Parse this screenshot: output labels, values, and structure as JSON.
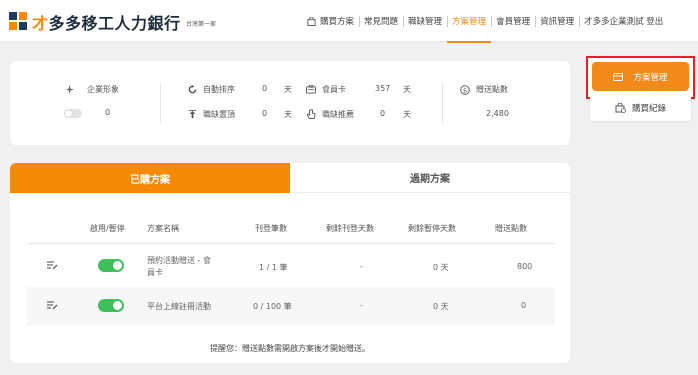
{
  "header": {
    "brand": "才多多移工人力銀行",
    "brand_sub": "台灣第一家",
    "nav": [
      {
        "label": "購買方案",
        "active": false
      },
      {
        "label": "常見問題",
        "active": false
      },
      {
        "label": "職缺管理",
        "active": false
      },
      {
        "label": "方案管理",
        "active": true
      },
      {
        "label": "會員管理",
        "active": false
      },
      {
        "label": "資訊管理",
        "active": false
      },
      {
        "label": "才多多企業測試 登出",
        "active": false
      }
    ]
  },
  "stats": {
    "enterprise_image": {
      "label": "企業形象",
      "value": "0"
    },
    "auto_sort": {
      "label": "自動排序",
      "value": "0",
      "unit": "天"
    },
    "job_top": {
      "label": "職缺置頂",
      "value": "0",
      "unit": "天"
    },
    "member_card": {
      "label": "會員卡",
      "value": "357",
      "unit": "天"
    },
    "job_recommend": {
      "label": "職缺推薦",
      "value": "0",
      "unit": "天"
    },
    "gift_points": {
      "label": "贈送點數",
      "value": "2,480"
    }
  },
  "side_menu": {
    "plan_manage": "方案管理",
    "purchase_record": "購買紀錄"
  },
  "plans": {
    "tabs": [
      "已購方案",
      "過期方案"
    ],
    "columns": [
      "啟用/暫停",
      "方案名稱",
      "刊登筆數",
      "剩餘刊登天數",
      "剩餘暫停天數",
      "贈送點數"
    ],
    "rows": [
      {
        "enabled": true,
        "name": "預約活動贈送 - 會員卡",
        "name_l1": "預約活動贈送 - 會",
        "name_l2": "員卡",
        "count": "1 / 1 筆",
        "remaining_post_days": "-",
        "remaining_pause_days": "0 天",
        "points": "800"
      },
      {
        "enabled": true,
        "name": "平台上線註冊活動",
        "count": "0 / 100 筆",
        "remaining_post_days": "-",
        "remaining_pause_days": "0 天",
        "points": "0"
      }
    ],
    "notice": "提醒您：贈送點數需開啟方案後才開始贈送。"
  },
  "colors": {
    "accent": "#f58a07",
    "toggle_on": "#3ec05c",
    "highlight_border": "#e32222"
  }
}
